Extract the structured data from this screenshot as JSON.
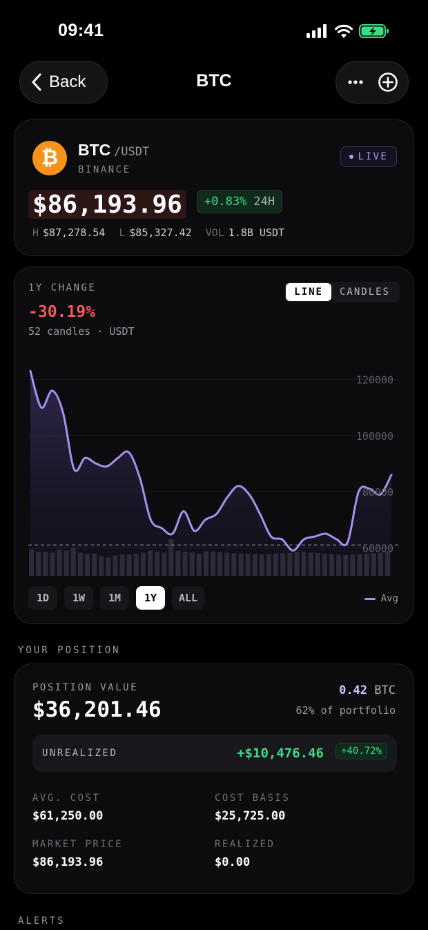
{
  "status_bar": {
    "time": "09:41"
  },
  "nav": {
    "back_label": "Back",
    "title": "BTC"
  },
  "ticker": {
    "logo_glyph": "₿",
    "symbol": "BTC",
    "pair": "/USDT",
    "exchange": "BINANCE",
    "live_label": "LIVE",
    "price": "$86,193.96",
    "change": "+0.83%",
    "change_period": "24H",
    "high_label": "H",
    "high": "$87,278.54",
    "low_label": "L",
    "low": "$85,327.42",
    "vol_label": "VOL",
    "volume": "1.8B USDT"
  },
  "chart_panel": {
    "change_label": "1Y CHANGE",
    "change_value": "-30.19%",
    "subtitle": "52 candles · USDT",
    "mode_tabs": [
      "LINE",
      "CANDLES"
    ],
    "active_mode": "LINE",
    "ranges": [
      "1D",
      "1W",
      "1M",
      "1Y",
      "ALL"
    ],
    "active_range": "1Y",
    "legend_label": "Avg"
  },
  "chart_data": {
    "type": "line",
    "ylim": [
      50000,
      128000
    ],
    "y_ticks": [
      120000,
      100000,
      80000,
      60000
    ],
    "avg": 61000,
    "series": [
      {
        "values": [
          123000,
          110000,
          116000,
          108000,
          88000,
          92000,
          90000,
          89000,
          92000,
          94000,
          85000,
          70000,
          67000,
          65000,
          73000,
          66000,
          70000,
          72000,
          78000,
          82000,
          79000,
          72000,
          64000,
          63000,
          59000,
          63000,
          64000,
          65000,
          63000,
          62000,
          80000,
          81000,
          79000,
          86000
        ]
      }
    ],
    "volume": [
      0.55,
      0.5,
      0.5,
      0.48,
      0.55,
      0.52,
      0.58,
      0.48,
      0.45,
      0.46,
      0.4,
      0.38,
      0.42,
      0.44,
      0.44,
      0.46,
      0.48,
      0.52,
      0.5,
      0.48,
      0.76,
      0.52,
      0.5,
      0.48,
      0.46,
      0.5,
      0.5,
      0.49,
      0.48,
      0.47,
      0.46,
      0.46,
      0.45,
      0.44,
      0.45,
      0.46,
      0.47,
      0.48,
      0.5,
      0.49,
      0.48,
      0.47,
      0.46,
      0.45,
      0.44,
      0.43,
      0.44,
      0.45,
      0.46,
      0.47,
      0.48,
      0.5
    ]
  },
  "position": {
    "section_label": "YOUR POSITION",
    "value_label": "POSITION VALUE",
    "value": "$36,201.46",
    "qty": "0.42",
    "qty_unit": "BTC",
    "portfolio_pct": "62% of portfolio",
    "unrealized_label": "UNREALIZED",
    "unrealized_value": "+$10,476.46",
    "unrealized_pct": "+40.72%",
    "avg_cost_label": "AVG. COST",
    "avg_cost": "$61,250.00",
    "cost_basis_label": "COST BASIS",
    "cost_basis": "$25,725.00",
    "market_price_label": "MARKET PRICE",
    "market_price": "$86,193.96",
    "realized_label": "REALIZED",
    "realized": "$0.00"
  },
  "alerts": {
    "section_label": "ALERTS"
  },
  "colors": {
    "accent": "#a88ff0",
    "positive": "#3ddc84",
    "negative": "#f05a5a",
    "btc": "#f7931a"
  }
}
